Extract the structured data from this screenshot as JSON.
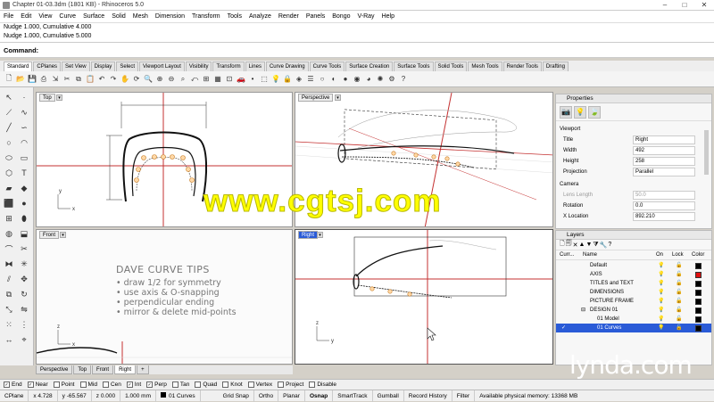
{
  "window": {
    "title": "Chapter 01-03.3dm (1801 KB) - Rhinoceros 5.0",
    "controls": [
      "–",
      "□",
      "✕"
    ]
  },
  "menu": [
    "File",
    "Edit",
    "View",
    "Curve",
    "Surface",
    "Solid",
    "Mesh",
    "Dimension",
    "Transform",
    "Tools",
    "Analyze",
    "Render",
    "Panels",
    "Bongo",
    "V-Ray",
    "Help"
  ],
  "command_history": [
    "Nudge 1.000, Cumulative 4.000",
    "Nudge 1.000, Cumulative 5.000"
  ],
  "command_prompt": "Command:",
  "toolbar_tabs": [
    "Standard",
    "CPlanes",
    "Set View",
    "Display",
    "Select",
    "Viewport Layout",
    "Visibility",
    "Transform",
    "Lines",
    "Curve Drawing",
    "Curve Tools",
    "Surface Creation",
    "Surface Tools",
    "Solid Tools",
    "Mesh Tools",
    "Render Tools",
    "Drafting"
  ],
  "active_toolbar_tab": "Standard",
  "viewports": {
    "top": {
      "label": "Top"
    },
    "perspective": {
      "label": "Perspective"
    },
    "front": {
      "label": "Front"
    },
    "right": {
      "label": "Right"
    }
  },
  "front_tips": {
    "heading": "DAVE CURVE TIPS",
    "items": [
      "• draw 1/2 for symmetry",
      "• use axis & O-snapping",
      "• perpendicular ending",
      "• mirror & delete mid-points"
    ]
  },
  "viewport_tabs": [
    "Perspective",
    "Top",
    "Front",
    "Right"
  ],
  "active_viewport_tab": "Right",
  "properties": {
    "title": "Properties",
    "section_viewport": "Viewport",
    "rows": [
      {
        "key": "Title",
        "value": "Right"
      },
      {
        "key": "Width",
        "value": "492"
      },
      {
        "key": "Height",
        "value": "258"
      },
      {
        "key": "Projection",
        "value": "Parallel"
      }
    ],
    "section_camera": "Camera",
    "camera_rows": [
      {
        "key": "Lens Length",
        "value": "50.0",
        "disabled": true
      },
      {
        "key": "Rotation",
        "value": "0.0"
      },
      {
        "key": "X Location",
        "value": "892.210"
      }
    ]
  },
  "layers": {
    "title": "Layers",
    "columns": {
      "current": "Curr...",
      "name": "Name",
      "on": "On",
      "lock": "Lock",
      "color": "Color"
    },
    "rows": [
      {
        "name": "Default",
        "indent": 0,
        "color": "#000000",
        "active": false
      },
      {
        "name": "AXIS",
        "indent": 0,
        "color": "#e01010",
        "active": false
      },
      {
        "name": "TITLES and TEXT",
        "indent": 0,
        "color": "#000000",
        "active": false
      },
      {
        "name": "DIMENSIONS",
        "indent": 0,
        "color": "#000000",
        "active": false
      },
      {
        "name": "PICTURE FRAME",
        "indent": 0,
        "color": "#000000",
        "active": false
      },
      {
        "name": "DESIGN 01",
        "indent": 0,
        "color": "#000000",
        "active": false,
        "collapsible": true
      },
      {
        "name": "01 Model",
        "indent": 1,
        "color": "#000000",
        "active": false
      },
      {
        "name": "01 Curves",
        "indent": 1,
        "color": "#000000",
        "active": true,
        "current": true
      }
    ]
  },
  "osnaps": [
    {
      "label": "End",
      "checked": true
    },
    {
      "label": "Near",
      "checked": true
    },
    {
      "label": "Point",
      "checked": false
    },
    {
      "label": "Mid",
      "checked": false
    },
    {
      "label": "Cen",
      "checked": false
    },
    {
      "label": "Int",
      "checked": true
    },
    {
      "label": "Perp",
      "checked": true
    },
    {
      "label": "Tan",
      "checked": false
    },
    {
      "label": "Quad",
      "checked": false
    },
    {
      "label": "Knot",
      "checked": false
    },
    {
      "label": "Vertex",
      "checked": false
    },
    {
      "label": "Project",
      "checked": false
    },
    {
      "label": "Disable",
      "checked": false
    }
  ],
  "status": {
    "cplane": "CPlane",
    "x": "x 4.728",
    "y": "y -65.567",
    "z": "z 0.000",
    "units": "1.000 mm",
    "layer": "01 Curves",
    "toggles": [
      "Grid Snap",
      "Ortho",
      "Planar",
      "Osnap",
      "SmartTrack",
      "Gumball",
      "Record History",
      "Filter"
    ],
    "memory": "Available physical memory: 13368 MB"
  },
  "watermark": "www.cgtsj.com",
  "brand": "lynda.com"
}
